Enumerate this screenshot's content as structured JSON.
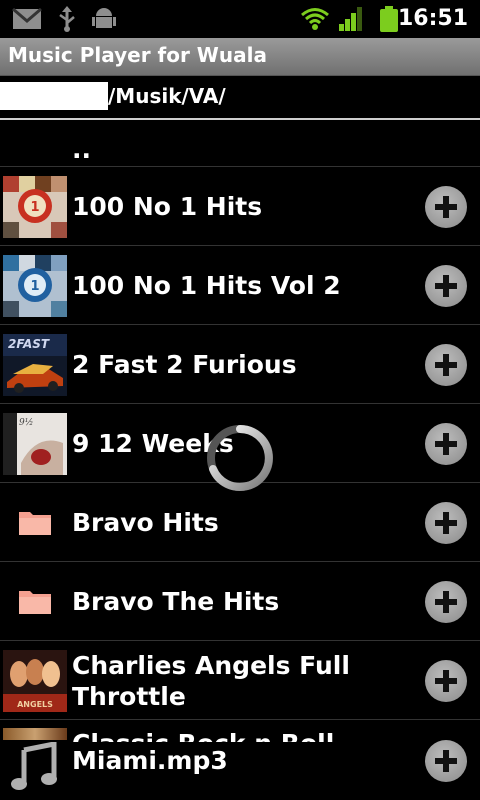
{
  "status_bar": {
    "time": "16:51",
    "icons": [
      "gmail-icon",
      "usb-icon",
      "android-debug-icon",
      "wifi-icon",
      "signal-icon",
      "battery-icon"
    ]
  },
  "app": {
    "title": "Music Player for Wuala"
  },
  "path": {
    "text": "/Musik/VA/"
  },
  "list": {
    "parent_label": "..",
    "items": [
      {
        "label": "100 No 1 Hits",
        "kind": "album"
      },
      {
        "label": "100 No 1 Hits Vol 2",
        "kind": "album"
      },
      {
        "label": "2 Fast 2 Furious",
        "kind": "album"
      },
      {
        "label": "9 12 Weeks",
        "kind": "album"
      },
      {
        "label": "Bravo Hits",
        "kind": "folder"
      },
      {
        "label": "Bravo The Hits",
        "kind": "folder"
      },
      {
        "label": "Charlies Angels Full Throttle",
        "kind": "album"
      }
    ],
    "partial_item_label": "Classic Rock n Roll"
  },
  "now_playing": {
    "label": "Miami.mp3"
  },
  "colors": {
    "titlebar": "#8a8a8a",
    "folder": "#f4a090",
    "add_button": "#9a9a9a"
  }
}
